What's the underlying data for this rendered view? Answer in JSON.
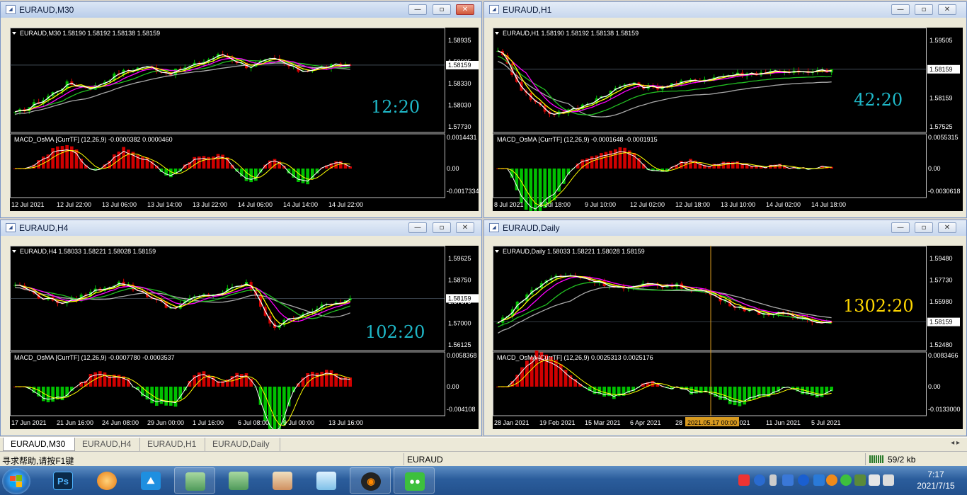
{
  "windows": [
    {
      "id": "m30",
      "title": "EURAUD,M30",
      "active": true,
      "chart": {
        "label": "EURAUD,M30",
        "ohlc": "1.58190 1.58192 1.58138 1.58159",
        "countdown": "12:20",
        "current_price": "1.58159",
        "price_ticks": [
          "1.58935",
          "1.58635",
          "1.58330",
          "1.58030",
          "1.57730"
        ],
        "macd_label": "MACD_OsMA [CurrTF] (12,26,9) -0.0000382 0.0000460",
        "macd_ticks": [
          "0.0014431",
          "0.00",
          "-0.0017334"
        ],
        "time_ticks": [
          "12 Jul 2021",
          "12 Jul 22:00",
          "13 Jul 06:00",
          "13 Jul 14:00",
          "13 Jul 22:00",
          "14 Jul 06:00",
          "14 Jul 14:00",
          "14 Jul 22:00"
        ]
      }
    },
    {
      "id": "h1",
      "title": "EURAUD,H1",
      "active": false,
      "chart": {
        "label": "EURAUD,H1",
        "ohlc": "1.58190 1.58192 1.58138 1.58159",
        "countdown": "42:20",
        "current_price": "1.58159",
        "price_ticks": [
          "1.59505",
          "1.58845",
          "1.58159",
          "1.57525"
        ],
        "macd_label": "MACD_OsMA [CurrTF] (12,26,9) -0.0001648 -0.0001915",
        "macd_ticks": [
          "0.0055315",
          "0.00",
          "-0.0030618"
        ],
        "time_ticks": [
          "8 Jul 2021",
          "8 Jul 18:00",
          "9 Jul 10:00",
          "12 Jul 02:00",
          "12 Jul 18:00",
          "13 Jul 10:00",
          "14 Jul 02:00",
          "14 Jul 18:00"
        ]
      }
    },
    {
      "id": "h4",
      "title": "EURAUD,H4",
      "active": false,
      "chart": {
        "label": "EURAUD,H4",
        "ohlc": "1.58033 1.58221 1.58028 1.58159",
        "countdown": "102:20",
        "current_price": "1.58159",
        "price_ticks": [
          "1.59625",
          "1.58750",
          "1.57875",
          "1.57000",
          "1.56125"
        ],
        "macd_label": "MACD_OsMA [CurrTF] (12,26,9) -0.0007780 -0.0003537",
        "macd_ticks": [
          "0.0058368",
          "0.00",
          "-0.004108"
        ],
        "time_ticks": [
          "17 Jun 2021",
          "21 Jun 16:00",
          "24 Jun 08:00",
          "29 Jun 00:00",
          "1 Jul 16:00",
          "6 Jul 08:00",
          "9 Jul 00:00",
          "13 Jul 16:00"
        ]
      }
    },
    {
      "id": "daily",
      "title": "EURAUD,Daily",
      "active": false,
      "chart": {
        "label": "EURAUD,Daily",
        "ohlc": "1.58033 1.58221 1.58028 1.58159",
        "countdown": "1302:20",
        "current_price": "1.58159",
        "price_ticks": [
          "1.59480",
          "1.57730",
          "1.55980",
          "1.54230",
          "1.52480"
        ],
        "macd_label": "MACD_OsMA [CurrTF] (12,26,9) 0.0025313 0.0025176",
        "macd_ticks": [
          "0.0083466",
          "0.00",
          "-0.0133000"
        ],
        "time_ticks": [
          "28 Jan 2021",
          "19 Feb 2021",
          "15 Mar 2021",
          "6 Apr 2021",
          "28",
          "1 Jul 2021",
          "11 Jun 2021",
          "5 Jul 2021"
        ],
        "crosshair_label": "2021.05.17 00:00"
      }
    }
  ],
  "tabs": [
    "EURAUD,M30",
    "EURAUD,H4",
    "EURAUD,H1",
    "EURAUD,Daily"
  ],
  "status": {
    "help": "寻求帮助,请按F1键",
    "symbol": "EURAUD",
    "traffic": "59/2 kb"
  },
  "clock": {
    "time": "7:17",
    "date": "2021/7/15"
  },
  "colors": {
    "bull": "#00c000",
    "bear": "#d00000",
    "ma_white": "#ffffff",
    "ma_yellow": "#ffff00",
    "ma_magenta": "#ff00ff",
    "ma_green": "#22c022",
    "ma_silver": "#a9a9a9",
    "countdown": "#1fb8c8",
    "countdown_daily": "#ffd700"
  }
}
